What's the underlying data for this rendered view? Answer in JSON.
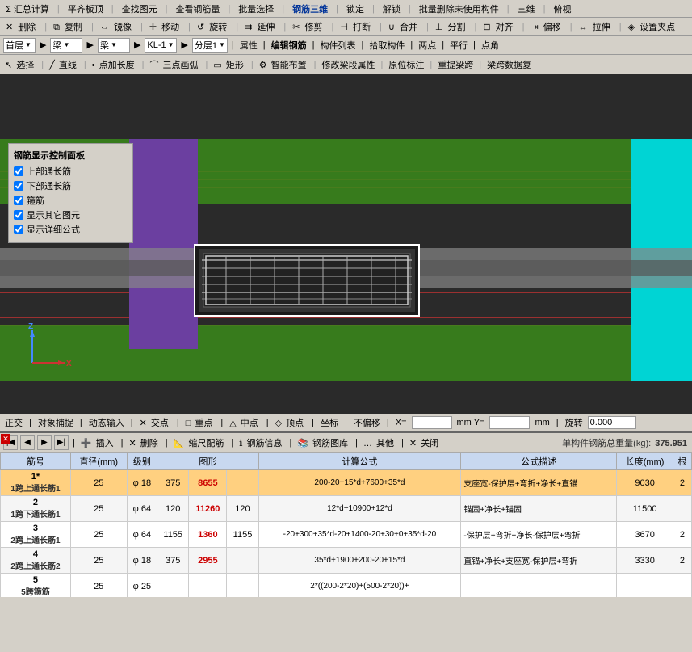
{
  "app": {
    "title": "钢筋三维"
  },
  "toolbars": {
    "top": {
      "items": [
        "Σ 汇总计算",
        "平齐板顶",
        "查找图元",
        "查看钢筋量",
        "批量选择",
        "钢筋三维",
        "锁定",
        "解锁",
        "批量删除未使用构件",
        "三维",
        "俯视"
      ]
    },
    "second": {
      "items": [
        "删除",
        "复制",
        "镜像",
        "移动",
        "旋转",
        "延伸",
        "修剪",
        "打断",
        "合并",
        "分割",
        "对齐",
        "偏移",
        "拉伸",
        "设置夹点"
      ]
    },
    "third": {
      "layer_label": "首层",
      "type_label": "梁",
      "element_label": "梁",
      "code_label": "KL-1",
      "sublayer_label": "分层1",
      "items": [
        "属性",
        "编辑钢筋",
        "构件列表",
        "拾取构件",
        "两点",
        "平行",
        "点角"
      ]
    },
    "fourth": {
      "items": [
        "选择",
        "直线",
        "点加长度",
        "三点画弧",
        "矩形",
        "智能布置",
        "修改梁段属性",
        "原位标注",
        "重提梁跨",
        "梁跨数据复"
      ]
    }
  },
  "control_panel": {
    "title": "钢筋显示控制面板",
    "items": [
      "上部通长筋",
      "下部通长筋",
      "箍筋",
      "显示其它图元",
      "显示详细公式"
    ]
  },
  "coord_bar": {
    "items": [
      "正交",
      "对象捕捉",
      "动态输入",
      "交点",
      "重点",
      "中点",
      "顶点",
      "坐标"
    ],
    "snap_label": "不偏移",
    "x_label": "X=",
    "x_value": "",
    "y_label": "mm Y=",
    "y_value": "",
    "mm_label": "mm",
    "rotate_label": "旋转",
    "rotate_value": "0.000"
  },
  "bottom_toolbar": {
    "items": [
      "插入",
      "删除",
      "缩尺配筋",
      "钢筋信息",
      "钢筋图库",
      "其他",
      "关闭"
    ],
    "total_weight_label": "单构件钢筋总重量(kg):",
    "total_weight_value": "375.951"
  },
  "table": {
    "headers": [
      "筋号",
      "直径(mm)",
      "级别",
      "图形",
      "",
      "计算公式",
      "",
      "公式描述",
      "长度(mm)",
      "根"
    ],
    "rows": [
      {
        "id": "1*",
        "name": "1跨上通长筋1",
        "diameter": "25",
        "grade": "φ",
        "level": "18",
        "left_val": "375",
        "formula": "8655",
        "right_val": "",
        "calc": "200-20+15*d+7600+35*d",
        "desc": "支座宽-保护层+弯折+净长+直锚",
        "length": "9030",
        "count": "2",
        "selected": true
      },
      {
        "id": "2",
        "name": "1跨下通长筋1",
        "diameter": "25",
        "grade": "φ",
        "level": "64",
        "left_val": "120",
        "formula": "11260",
        "right_val": "120",
        "calc": "12*d+10900+12*d",
        "desc": "锚固+净长+锚固",
        "length": "11500",
        "count": "",
        "selected": false
      },
      {
        "id": "3",
        "name": "2跨上通长筋1",
        "diameter": "25",
        "grade": "φ",
        "level": "64",
        "left_val": "1155",
        "formula": "1360",
        "right_val": "1155",
        "calc": "-20+300+35*d-20+1400-20+30+0+35*d-20",
        "desc": "-保护层+弯折+净长-保护层+弯折",
        "length": "3670",
        "count": "2",
        "selected": false
      },
      {
        "id": "4",
        "name": "2跨上通长筋2",
        "diameter": "25",
        "grade": "φ",
        "level": "18",
        "left_val": "375",
        "formula": "2955",
        "right_val": "",
        "calc": "35*d+1900+200-20+15*d",
        "desc": "直锚+净长+支座宽-保护层+弯折",
        "length": "3330",
        "count": "2",
        "selected": false
      },
      {
        "id": "5",
        "name": "5跨箍筋",
        "diameter": "25",
        "grade": "φ",
        "level": "25",
        "left_val": "",
        "formula": "",
        "right_val": "",
        "calc": "2*((200-2*20)+(500-2*20))+",
        "desc": "",
        "length": "",
        "count": "",
        "selected": false
      }
    ]
  }
}
